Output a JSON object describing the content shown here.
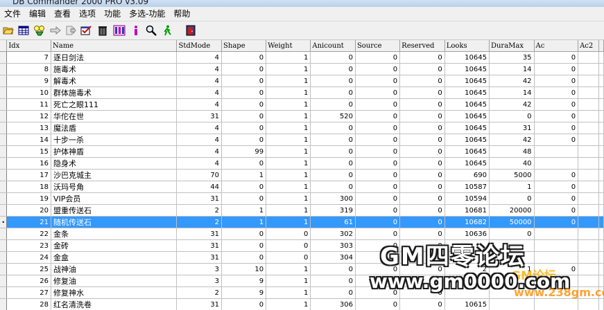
{
  "window": {
    "title": "DB Commander 2000 PRO v3.09"
  },
  "menu": [
    "文件",
    "编辑",
    "查看",
    "选项",
    "功能",
    "多选-功能",
    "帮助"
  ],
  "table": {
    "columns": [
      "Idx",
      "Name",
      "StdMode",
      "Shape",
      "Weight",
      "Anicount",
      "Source",
      "Reserved",
      "Looks",
      "DuraMax",
      "Ac",
      "Ac2"
    ],
    "selected_index": 14,
    "current_marker": "•",
    "rows": [
      [
        "7",
        "逐日剑法",
        "4",
        "0",
        "1",
        "0",
        "0",
        "0",
        "10645",
        "35",
        "0",
        ""
      ],
      [
        "8",
        "施毒术",
        "4",
        "0",
        "1",
        "0",
        "0",
        "0",
        "10645",
        "14",
        "0",
        ""
      ],
      [
        "9",
        "解毒术",
        "4",
        "0",
        "1",
        "0",
        "0",
        "0",
        "10645",
        "42",
        "0",
        ""
      ],
      [
        "10",
        "群体施毒术",
        "4",
        "0",
        "1",
        "0",
        "0",
        "0",
        "10645",
        "14",
        "0",
        ""
      ],
      [
        "11",
        "死亡之眼111",
        "4",
        "0",
        "1",
        "0",
        "0",
        "0",
        "10645",
        "42",
        "0",
        ""
      ],
      [
        "12",
        "华佗在世",
        "31",
        "0",
        "1",
        "520",
        "0",
        "0",
        "10645",
        "0",
        "0",
        ""
      ],
      [
        "13",
        "魔法盾",
        "4",
        "0",
        "1",
        "0",
        "0",
        "0",
        "10645",
        "31",
        "0",
        ""
      ],
      [
        "14",
        "十步一杀",
        "4",
        "0",
        "1",
        "0",
        "0",
        "0",
        "10645",
        "42",
        "0",
        ""
      ],
      [
        "15",
        "护体神盾",
        "4",
        "99",
        "1",
        "0",
        "0",
        "0",
        "10645",
        "48",
        "",
        ""
      ],
      [
        "16",
        "隐身术",
        "4",
        "0",
        "1",
        "0",
        "0",
        "0",
        "10645",
        "40",
        "",
        ""
      ],
      [
        "17",
        "沙巴克城主",
        "70",
        "1",
        "1",
        "0",
        "0",
        "0",
        "690",
        "5000",
        "0",
        ""
      ],
      [
        "18",
        "沃玛号角",
        "44",
        "0",
        "1",
        "0",
        "0",
        "0",
        "10587",
        "1",
        "0",
        ""
      ],
      [
        "19",
        "VIP会员",
        "31",
        "0",
        "1",
        "300",
        "0",
        "0",
        "10594",
        "0",
        "0",
        ""
      ],
      [
        "20",
        "盟重传送石",
        "2",
        "1",
        "1",
        "319",
        "0",
        "0",
        "10681",
        "20000",
        "0",
        ""
      ],
      [
        "21",
        "随机传送石",
        "2",
        "1",
        "1",
        "61",
        "0",
        "0",
        "10682",
        "50000",
        "0",
        ""
      ],
      [
        "22",
        "金条",
        "31",
        "0",
        "0",
        "302",
        "0",
        "0",
        "10636",
        "0",
        "",
        ""
      ],
      [
        "23",
        "金砖",
        "31",
        "0",
        "0",
        "303",
        "0",
        "0",
        "",
        "",
        "",
        ""
      ],
      [
        "24",
        "金盒",
        "31",
        "0",
        "0",
        "304",
        "0",
        "0",
        "",
        "",
        "",
        ""
      ],
      [
        "25",
        "战神油",
        "3",
        "10",
        "1",
        "0",
        "0",
        "0",
        "2",
        "1",
        "0",
        ""
      ],
      [
        "26",
        "修复油",
        "3",
        "9",
        "1",
        "0",
        "0",
        "",
        "",
        "",
        "",
        ""
      ],
      [
        "27",
        "修复神水",
        "2",
        "9",
        "1",
        "0",
        "0",
        "0",
        "",
        "",
        "",
        ""
      ],
      [
        "28",
        "红名清洗卷",
        "31",
        "0",
        "1",
        "306",
        "0",
        "0",
        "10615",
        "",
        "",
        ""
      ]
    ]
  },
  "watermark": {
    "line1": "GM四零论坛",
    "line2": "www.gm0000.com",
    "line3": "GM论坛",
    "line4": "www.238gm.com"
  }
}
